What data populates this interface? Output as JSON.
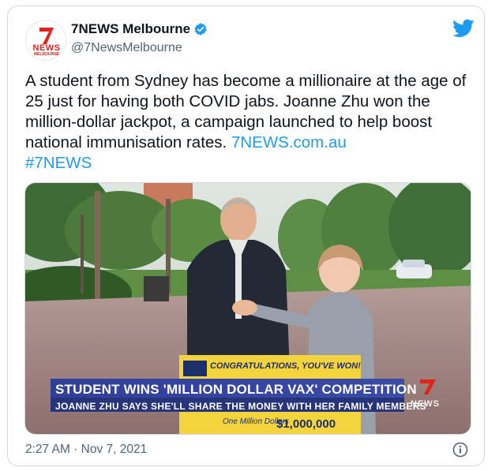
{
  "author": {
    "display_name": "7NEWS Melbourne",
    "handle": "@7NewsMelbourne",
    "verified_icon": "verified-badge-icon",
    "avatar_logo_text": "NEWS",
    "avatar_sub_text": "MELBOURNE"
  },
  "tweet": {
    "text": "A student from Sydney has become a millionaire at the age of 25 just for having both COVID jabs. Joanne Zhu won the million-dollar jackpot, a campaign launched to help boost national immunisation rates. ",
    "link": "7NEWS.com.au",
    "hashtag": "#7NEWS"
  },
  "media": {
    "headline": "STUDENT WINS 'MILLION DOLLAR VAX' COMPETITION",
    "subline": "JOANNE ZHU SAYS SHE'LL SHARE THE MONEY WITH HER FAMILY MEMBERS",
    "cheque_title": "CONGRATULATIONS, YOU'VE WON!",
    "cheque_words": "One Million Dollars",
    "cheque_amount": "$1,000,000",
    "watermark": "NEWS"
  },
  "footer": {
    "timestamp": "2:27 AM · Nov 7, 2021",
    "info_icon": "info-icon"
  },
  "colors": {
    "link_blue": "#1d9bf0",
    "text": "#0f1419",
    "muted": "#536471",
    "seven_red": "#e2231a",
    "banner_blue": "#2b3b8f"
  }
}
